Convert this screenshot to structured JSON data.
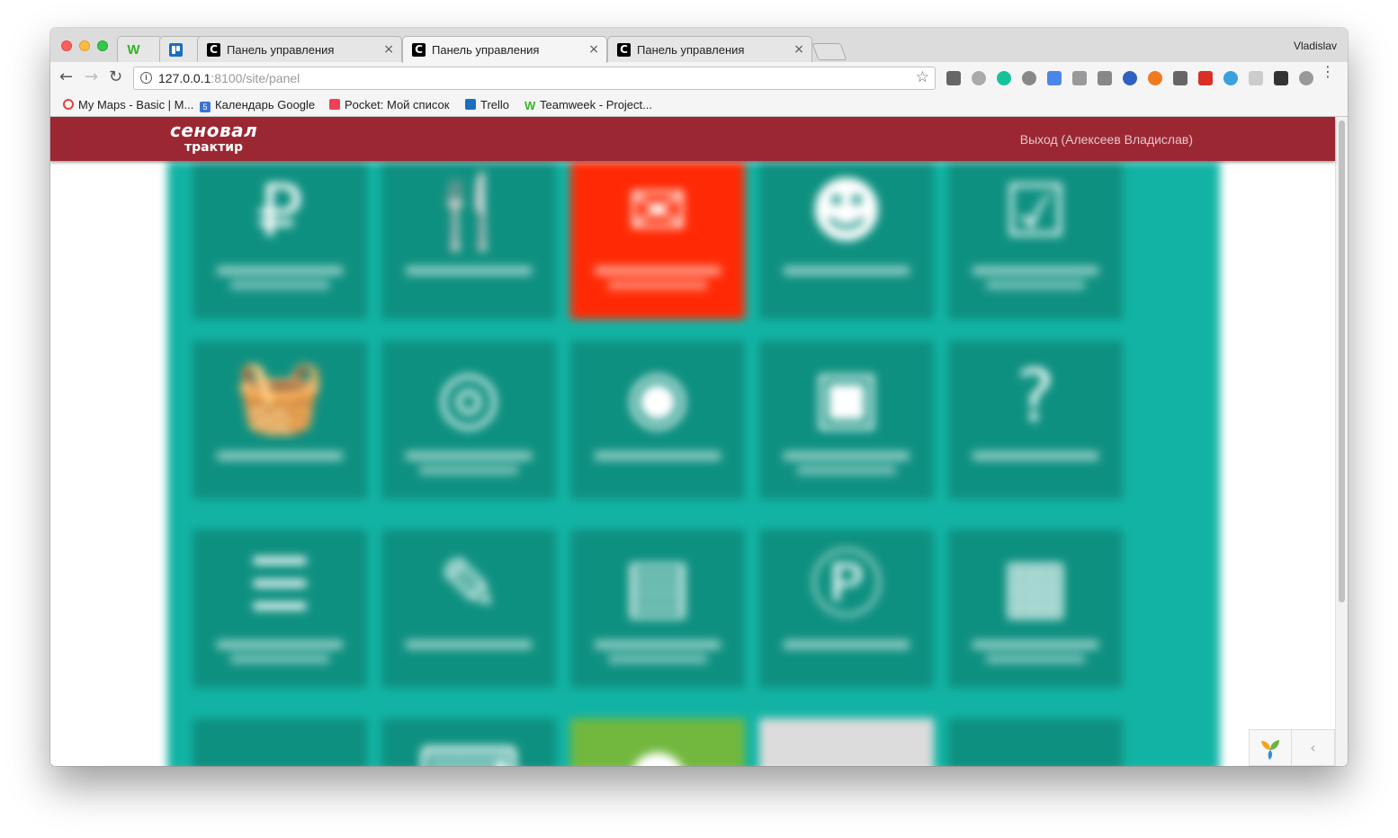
{
  "browser": {
    "profile_name": "Vladislav",
    "tabs": [
      {
        "label": "",
        "icon": "w-icon"
      },
      {
        "label": "",
        "icon": "trello-icon"
      },
      {
        "label": "Панель управления",
        "icon": "c-icon",
        "close": "×"
      },
      {
        "label": "Панель управления",
        "icon": "c-icon",
        "close": "×",
        "active": true
      },
      {
        "label": "Панель управления",
        "icon": "c-icon",
        "close": "×"
      }
    ],
    "address": {
      "host": "127.0.0.1",
      "rest": ":8100/site/panel"
    },
    "nav": {
      "back": "←",
      "forward": "→",
      "reload": "↻",
      "star": "☆",
      "info": "i",
      "menu": "⋮"
    },
    "bookmarks": [
      {
        "label": "My Maps - Basic | M...",
        "icon": "maps-icon",
        "color": "#e8403a"
      },
      {
        "label": "Календарь Google",
        "icon": "calendar-icon",
        "color": "#3b73d6",
        "badge": "5"
      },
      {
        "label": "Pocket: Мой список",
        "icon": "pocket-icon",
        "color": "#ef4056"
      },
      {
        "label": "Trello",
        "icon": "trello-icon",
        "color": "#1a6ec0"
      },
      {
        "label": "Teamweek - Project...",
        "icon": "teamweek-icon",
        "color": "#33b525"
      }
    ]
  },
  "site": {
    "logo_line1": "сеновал",
    "logo_line2": "трактир",
    "logout_text": "Выход (Алексеев Владислав)",
    "accent_color": "#9b2732",
    "panel_color": "#12b3a4",
    "tile_color": "#0e9080"
  },
  "tiles": [
    {
      "icon": "ruble-icon",
      "glyph": "₽",
      "color": "teal"
    },
    {
      "icon": "fork-knife-icon",
      "glyph": "🍴",
      "color": "teal"
    },
    {
      "icon": "envelope-icon",
      "glyph": "✉",
      "color": "orange"
    },
    {
      "icon": "users-icon",
      "glyph": "☻",
      "color": "teal"
    },
    {
      "icon": "checkbox-icon",
      "glyph": "☑",
      "color": "teal"
    },
    {
      "icon": "basket-icon",
      "glyph": "🧺",
      "color": "teal"
    },
    {
      "icon": "lifebuoy-icon",
      "glyph": "◎",
      "color": "teal"
    },
    {
      "icon": "eye-icon",
      "glyph": "◉",
      "color": "teal"
    },
    {
      "icon": "money-icon",
      "glyph": "▣",
      "color": "teal"
    },
    {
      "icon": "question-icon",
      "glyph": "?",
      "color": "teal"
    },
    {
      "icon": "list-icon",
      "glyph": "☰",
      "color": "teal"
    },
    {
      "icon": "pencil-icon",
      "glyph": "✎",
      "color": "teal"
    },
    {
      "icon": "document-icon",
      "glyph": "▤",
      "color": "teal"
    },
    {
      "icon": "circle-p-icon",
      "glyph": "Ⓟ",
      "color": "teal"
    },
    {
      "icon": "table-icon",
      "glyph": "▦",
      "color": "teal"
    },
    {
      "icon": "chart-icon",
      "glyph": "▂",
      "color": "teal"
    },
    {
      "icon": "keyboard-icon",
      "glyph": "⌨",
      "color": "teal"
    },
    {
      "icon": "circle-icon",
      "glyph": "●",
      "color": "green"
    },
    {
      "icon": "blank-icon",
      "glyph": "",
      "color": "gray"
    },
    {
      "icon": "cloud-icon",
      "glyph": "☁",
      "color": "teal"
    }
  ],
  "debug_toolbar": {
    "collapse_glyph": "‹"
  }
}
